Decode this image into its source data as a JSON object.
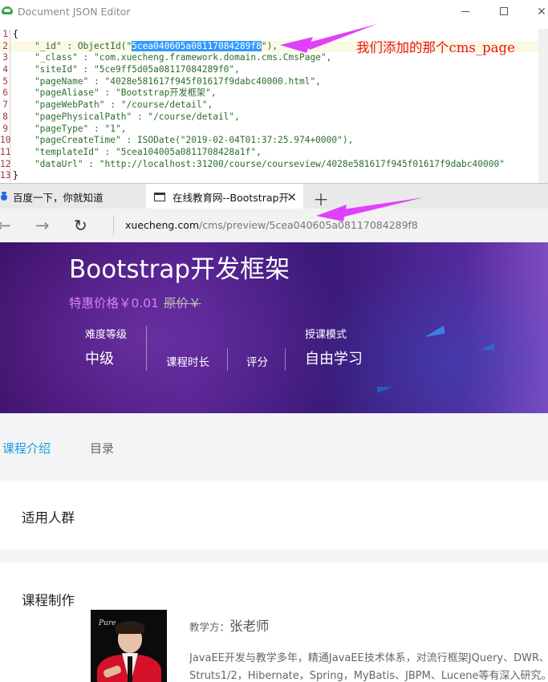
{
  "editor": {
    "window_title": "Document JSON Editor",
    "annotation": "我们添加的那个cms_page",
    "lines": [
      {
        "n": "1",
        "text": "{"
      },
      {
        "n": "2",
        "pre": "    \"_id\" : ObjectId(\"",
        "sel": "5cea040605a08117084289f8",
        "post": "\"),"
      },
      {
        "n": "3",
        "text": "    \"_class\" : \"com.xuecheng.framework.domain.cms.CmsPage\","
      },
      {
        "n": "4",
        "text": "    \"siteId\" : \"5ce9ff5d05a08117084289f0\","
      },
      {
        "n": "5",
        "text": "    \"pageName\" : \"4028e581617f945f01617f9dabc40000.html\","
      },
      {
        "n": "6",
        "text": "    \"pageAliase\" : \"Bootstrap开发框架\","
      },
      {
        "n": "7",
        "text": "    \"pageWebPath\" : \"/course/detail\","
      },
      {
        "n": "8",
        "text": "    \"pagePhysicalPath\" : \"/course/detail\","
      },
      {
        "n": "9",
        "text": "    \"pageType\" : \"1\","
      },
      {
        "n": "10",
        "text": "    \"pageCreateTime\" : ISODate(\"2019-02-04T01:37:25.974+0000\"),"
      },
      {
        "n": "11",
        "text": "    \"templateId\" : \"5cea104005a0811708428a1f\","
      },
      {
        "n": "12",
        "text": "    \"dataUrl\" : \"http://localhost:31200/course/courseview/4028e581617f945f01617f9dabc40000\""
      },
      {
        "n": "13",
        "text": "}"
      }
    ]
  },
  "browser": {
    "tabs": [
      {
        "label": "百度一下，你就知道",
        "icon": "baidu-paw-icon"
      },
      {
        "label": "在线教育网--Bootstrap开",
        "icon": "page-icon"
      }
    ],
    "url_host": "xuecheng.com",
    "url_path": "/cms/preview/5cea040605a08117084289f8"
  },
  "page": {
    "title": "Bootstrap开发框架",
    "price_label": "特惠价格￥0.01",
    "orig_price": "原价￥",
    "difficulty_label": "难度等级",
    "difficulty_value": "中级",
    "duration_label": "课程时长",
    "rating_label": "评分",
    "mode_label": "授课模式",
    "mode_value": "自由学习",
    "tab_intro": "课程介绍",
    "tab_toc": "目录",
    "audience_title": "适用人群",
    "production_title": "课程制作",
    "photo_caption": "Pure",
    "teacher_prefix": "教学方：",
    "teacher_name": "张老师",
    "teacher_desc_1": "JavaEE开发与教学多年，精通JavaEE技术体系，对流行框架JQuery、DWR、",
    "teacher_desc_2": "Struts1/2，Hibernate，Spring，MyBatis、JBPM、Lucene等有深入研究。"
  },
  "colors": {
    "selection": "#3399ff",
    "accent_blue": "#1a9bd7",
    "price_purple": "#d77fff",
    "annotation_red": "#ee1111",
    "arrow_magenta": "#e040fb"
  }
}
